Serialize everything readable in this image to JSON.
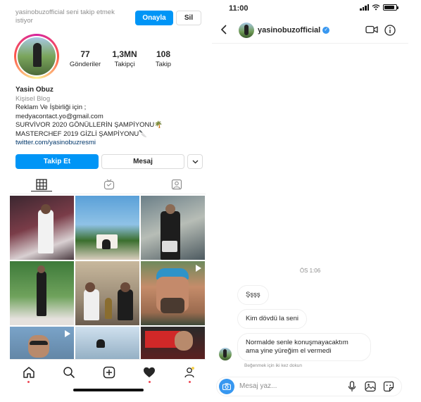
{
  "profile": {
    "follow_request_text": "yasinobuzofficial seni takip etmek istiyor",
    "accept_label": "Onayla",
    "delete_label": "Sil",
    "stats": [
      {
        "value": "77",
        "label": "Gönderiler"
      },
      {
        "value": "1,3MN",
        "label": "Takipçi"
      },
      {
        "value": "108",
        "label": "Takip"
      }
    ],
    "name": "Yasin Obuz",
    "category": "Kişisel Blog",
    "bio_lines": [
      "Reklam Ve İşbirliği için ;",
      "medyacontact.yo@gmail.com",
      "SURVİVOR 2020 GÖNÜLLERİN ŞAMPİYONU🌴",
      "MASTERCHEF 2019 GİZLİ ŞAMPİYONU🔪"
    ],
    "link": "twitter.com/yasinobuzresmi",
    "follow_label": "Takip Et",
    "message_label": "Mesaj",
    "tabs": [
      "grid-icon",
      "igtv-icon",
      "tagged-icon"
    ],
    "grid_count": 9
  },
  "bottom_nav": [
    "home-icon",
    "search-icon",
    "add-post-icon",
    "activity-icon",
    "profile-icon"
  ],
  "dm": {
    "status_time": "11:00",
    "username": "yasinobuzofficial",
    "verified": true,
    "timestamp": "ÖS 1:06",
    "messages": [
      "Şşşş",
      "Kim dövdü la seni",
      "Normalde senle konuşmayacaktım ama yine yüreğim el vermedi"
    ],
    "react_hint": "Beğenmek için iki kez dokun",
    "composer_placeholder": "Mesaj yaz...",
    "colors": {
      "accent": "#0095f6",
      "verified": "#3897f0",
      "notification": "#ed4956"
    }
  }
}
